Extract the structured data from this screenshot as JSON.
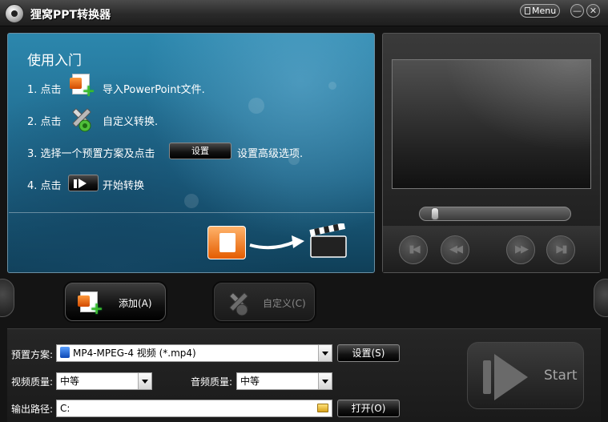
{
  "window": {
    "title": "狸窝PPT转换器",
    "menu_label": "Menu",
    "minimize_label": "—",
    "close_label": "✕"
  },
  "guide": {
    "title": "使用入门",
    "steps": [
      {
        "prefix": "1. 点击",
        "suffix": "导入PowerPoint文件."
      },
      {
        "prefix": "2. 点击",
        "suffix": "自定义转换."
      },
      {
        "prefix": "3. 选择一个预置方案及点击",
        "button": "设置",
        "suffix": "设置高级选项."
      },
      {
        "prefix": "4. 点击",
        "suffix": "开始转换"
      }
    ]
  },
  "preview": {
    "progress_fraction": 0.0,
    "controls": [
      "previous",
      "rewind",
      "fast-forward",
      "next"
    ]
  },
  "actions": {
    "add_label": "添加(A)",
    "customize_label": "自定义(C)",
    "customize_enabled": false
  },
  "settings": {
    "preset_label": "预置方案:",
    "preset_value": "MP4-MPEG-4 视频 (*.mp4)",
    "settings_button": "设置(S)",
    "video_quality_label": "视频质量:",
    "video_quality_value": "中等",
    "audio_quality_label": "音频质量:",
    "audio_quality_value": "中等",
    "output_label": "输出路径:",
    "output_value": "C:",
    "open_button": "打开(O)",
    "start_label": "Start"
  },
  "colors": {
    "guide_panel": "#1d6386",
    "window_bg": "#141414",
    "add_plus": "#3dbb2b"
  }
}
